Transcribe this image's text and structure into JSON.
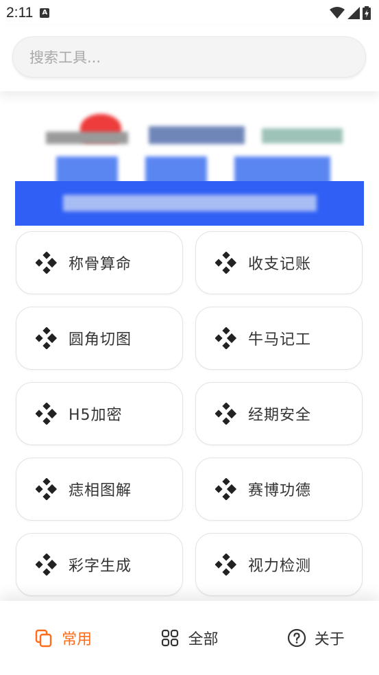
{
  "status_bar": {
    "time": "2:11",
    "notification_icon": "A"
  },
  "search": {
    "placeholder": "搜索工具..."
  },
  "tools": [
    {
      "label": "称骨算命",
      "icon": "kodi-diamond-icon"
    },
    {
      "label": "收支记账",
      "icon": "kodi-diamond-icon"
    },
    {
      "label": "圆角切图",
      "icon": "kodi-diamond-icon"
    },
    {
      "label": "牛马记工",
      "icon": "kodi-diamond-icon"
    },
    {
      "label": "H5加密",
      "icon": "kodi-diamond-icon"
    },
    {
      "label": "经期安全",
      "icon": "kodi-diamond-icon"
    },
    {
      "label": "痣相图解",
      "icon": "kodi-diamond-icon"
    },
    {
      "label": "赛博功德",
      "icon": "kodi-diamond-icon"
    },
    {
      "label": "彩字生成",
      "icon": "kodi-diamond-icon"
    },
    {
      "label": "视力检测",
      "icon": "kodi-diamond-icon"
    }
  ],
  "bottom_nav": {
    "items": [
      {
        "label": "常用",
        "icon": "copy-icon",
        "active": true
      },
      {
        "label": "全部",
        "icon": "grid-icon",
        "active": false
      },
      {
        "label": "关于",
        "icon": "help-circle-icon",
        "active": false
      }
    ]
  },
  "colors": {
    "accent": "#ff6b1a",
    "banner_blue": "#2f5ff5",
    "text": "#333333"
  }
}
